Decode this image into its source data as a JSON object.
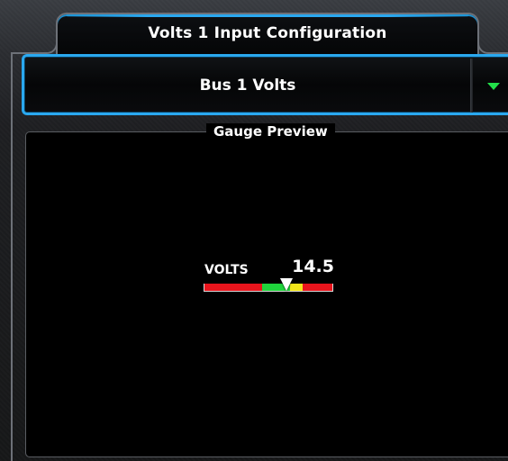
{
  "window": {
    "title": "Volts 1 Input Configuration"
  },
  "selector": {
    "value": "Bus 1 Volts",
    "arrow_icon": "triangle-down-icon",
    "arrow_color": "#22e04a",
    "border_color": "#2aa8ef"
  },
  "preview": {
    "title": "Gauge Preview",
    "gauge": {
      "label": "VOLTS",
      "value": "14.5",
      "pointer_fraction": 0.65,
      "bands": [
        {
          "name": "low-red",
          "color": "#e8141c",
          "fraction": 0.45
        },
        {
          "name": "green",
          "color": "#1fd43c",
          "fraction": 0.22
        },
        {
          "name": "yellow",
          "color": "#f2e51a",
          "fraction": 0.1
        },
        {
          "name": "high-red",
          "color": "#e8141c",
          "fraction": 0.23
        }
      ]
    }
  }
}
